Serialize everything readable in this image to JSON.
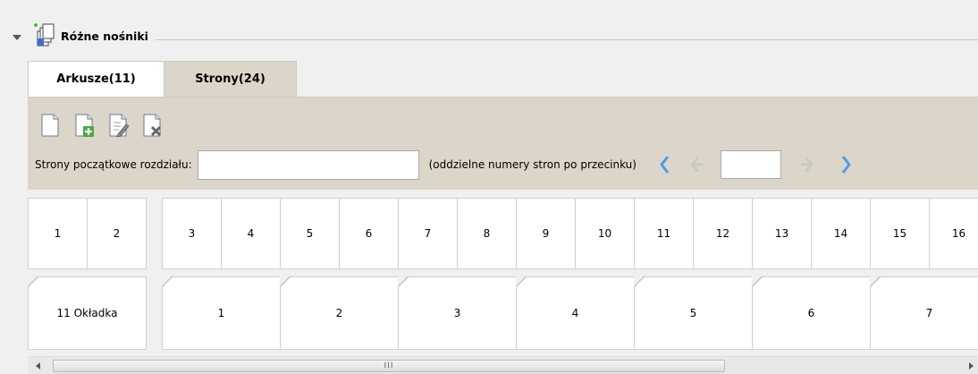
{
  "section": {
    "title": "Różne nośniki"
  },
  "tabs": [
    {
      "label": "Arkusze(11)"
    },
    {
      "label": "Strony(24)"
    }
  ],
  "toolbar": {
    "icons": [
      "new-page-icon",
      "add-page-icon",
      "edit-page-icon",
      "delete-page-icon"
    ],
    "chapter_label": "Strony początkowe rozdziału:",
    "chapter_value": "",
    "hint": "(oddzielne numery stron po przecinku)",
    "page_value": ""
  },
  "pages_row": [
    "1",
    "2",
    "3",
    "4",
    "5",
    "6",
    "7",
    "8",
    "9",
    "10",
    "11",
    "12",
    "13",
    "14",
    "15",
    "16"
  ],
  "sheets_row": [
    "11 Okładka",
    "1",
    "2",
    "3",
    "4",
    "5",
    "6",
    "7"
  ],
  "scrollbar": {
    "grip": "III"
  },
  "colors": {
    "panel": "#dcd6ca",
    "nav_arrow": "#4a9cf0",
    "nav_disabled": "#c8c8c8"
  }
}
